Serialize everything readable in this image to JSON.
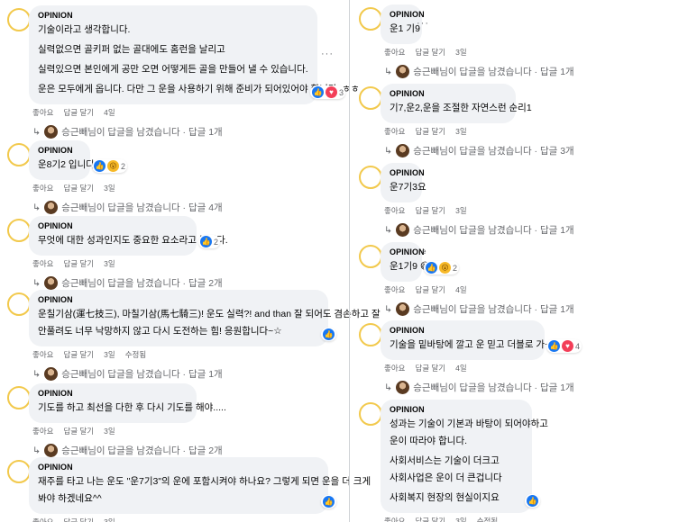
{
  "author": "OPINION",
  "actions": {
    "like": "좋아요",
    "reply": "답글 달기",
    "edited": "수정됨"
  },
  "left": [
    {
      "lines": [
        "기술이라고 생각합니다.",
        "실력없으면 골키퍼 없는 골대에도 홈런을 날리고",
        "실력있으면 본인에게 공만 오면 어떻게든 골을 만들어 낼 수 있습니다.",
        "운은 모두에게 옵니다. 다만 그 운을 사용하기 위해 준비가 되어있어야 합니다! ㅎㅎ"
      ],
      "time": "4일",
      "reactions": [
        "like",
        "love"
      ],
      "react_count": "3",
      "reply": "승근빼님이 답글을 남겼습니다 · 답글 1개",
      "ellipsis": "···"
    },
    {
      "lines": [
        "운8기2 입니다ㅋ"
      ],
      "time": "3일",
      "reactions": [
        "like",
        "wow"
      ],
      "react_count": "2",
      "reply": "승근빼님이 답글을 남겼습니다 · 답글 4개"
    },
    {
      "lines": [
        "무엇에 대한 성과인지도 중요한 요소라고 봅니다."
      ],
      "time": "3일",
      "reactions": [
        "like"
      ],
      "react_count": "2",
      "reply": "승근빼님이 답글을 남겼습니다 · 답글 2개"
    },
    {
      "lines": [
        "운칠기삼(運七技三), 마칠기삼(馬七騎三)! 운도 실력?! and than 잘 되어도 겸손하고 잘",
        "안풀려도 너무 낙망하지 않고 다시 도전하는 힘! 응원합니다~☆"
      ],
      "time": "3일",
      "edited": true,
      "reactions": [
        "like"
      ],
      "react_count": "",
      "reply": "승근빼님이 답글을 남겼습니다 · 답글 1개"
    },
    {
      "lines": [
        "기도를 하고 최선을 다한 후 다시 기도를 해야....."
      ],
      "time": "3일",
      "reactions": [],
      "react_count": "",
      "reply": "승근빼님이 답글을 남겼습니다 · 답글 2개"
    },
    {
      "lines": [
        "재주를 타고 나는 운도 \"운7기3\"의 운에 포함시켜야 하나요? 그렇게 되면 운을 더 크게",
        "봐야 하겠네요^^"
      ],
      "time": "3일",
      "reactions": [
        "like"
      ],
      "react_count": "",
      "reply": ""
    }
  ],
  "right": [
    {
      "lines": [
        "운1 기9"
      ],
      "time": "3일",
      "reactions": [],
      "react_count": "",
      "reply": "승근빼님이 답글을 남겼습니다 · 답글 1개",
      "ellipsis": "···"
    },
    {
      "lines": [
        "기7,운2,운을 조절한 자연스런 순리1"
      ],
      "time": "3일",
      "reactions": [],
      "react_count": "",
      "reply": "승근빼님이 답글을 남겼습니다 · 답글 3개"
    },
    {
      "lines": [
        "운7기3요"
      ],
      "time": "3일",
      "reactions": [],
      "react_count": "",
      "reply": "승근빼님이 답글을 남겼습니다 · 답글 1개"
    },
    {
      "lines": [
        "운1기9 😄"
      ],
      "time": "4일",
      "reactions": [
        "like",
        "wow"
      ],
      "react_count": "2",
      "reply": "승근빼님이 답글을 남겼습니다 · 답글 1개",
      "tag": "e"
    },
    {
      "lines": [
        "기술을 밑바탕에 깔고 운 믿고 더블로 가~^^"
      ],
      "time": "4일",
      "reactions": [
        "like",
        "love"
      ],
      "react_count": "4",
      "reply": "승근빼님이 답글을 남겼습니다 · 답글 1개"
    },
    {
      "lines": [
        "성과는 기술이 기본과 바탕이 되어야하고",
        "운이 따라야 합니다.",
        "사회서비스는 기술이 더크고",
        "사회사업은 운이 더 큰겁니다",
        "사회복지 현장의 현실이지요"
      ],
      "time": "3일",
      "edited": true,
      "reactions": [
        "like"
      ],
      "react_count": "",
      "reply": ""
    }
  ]
}
